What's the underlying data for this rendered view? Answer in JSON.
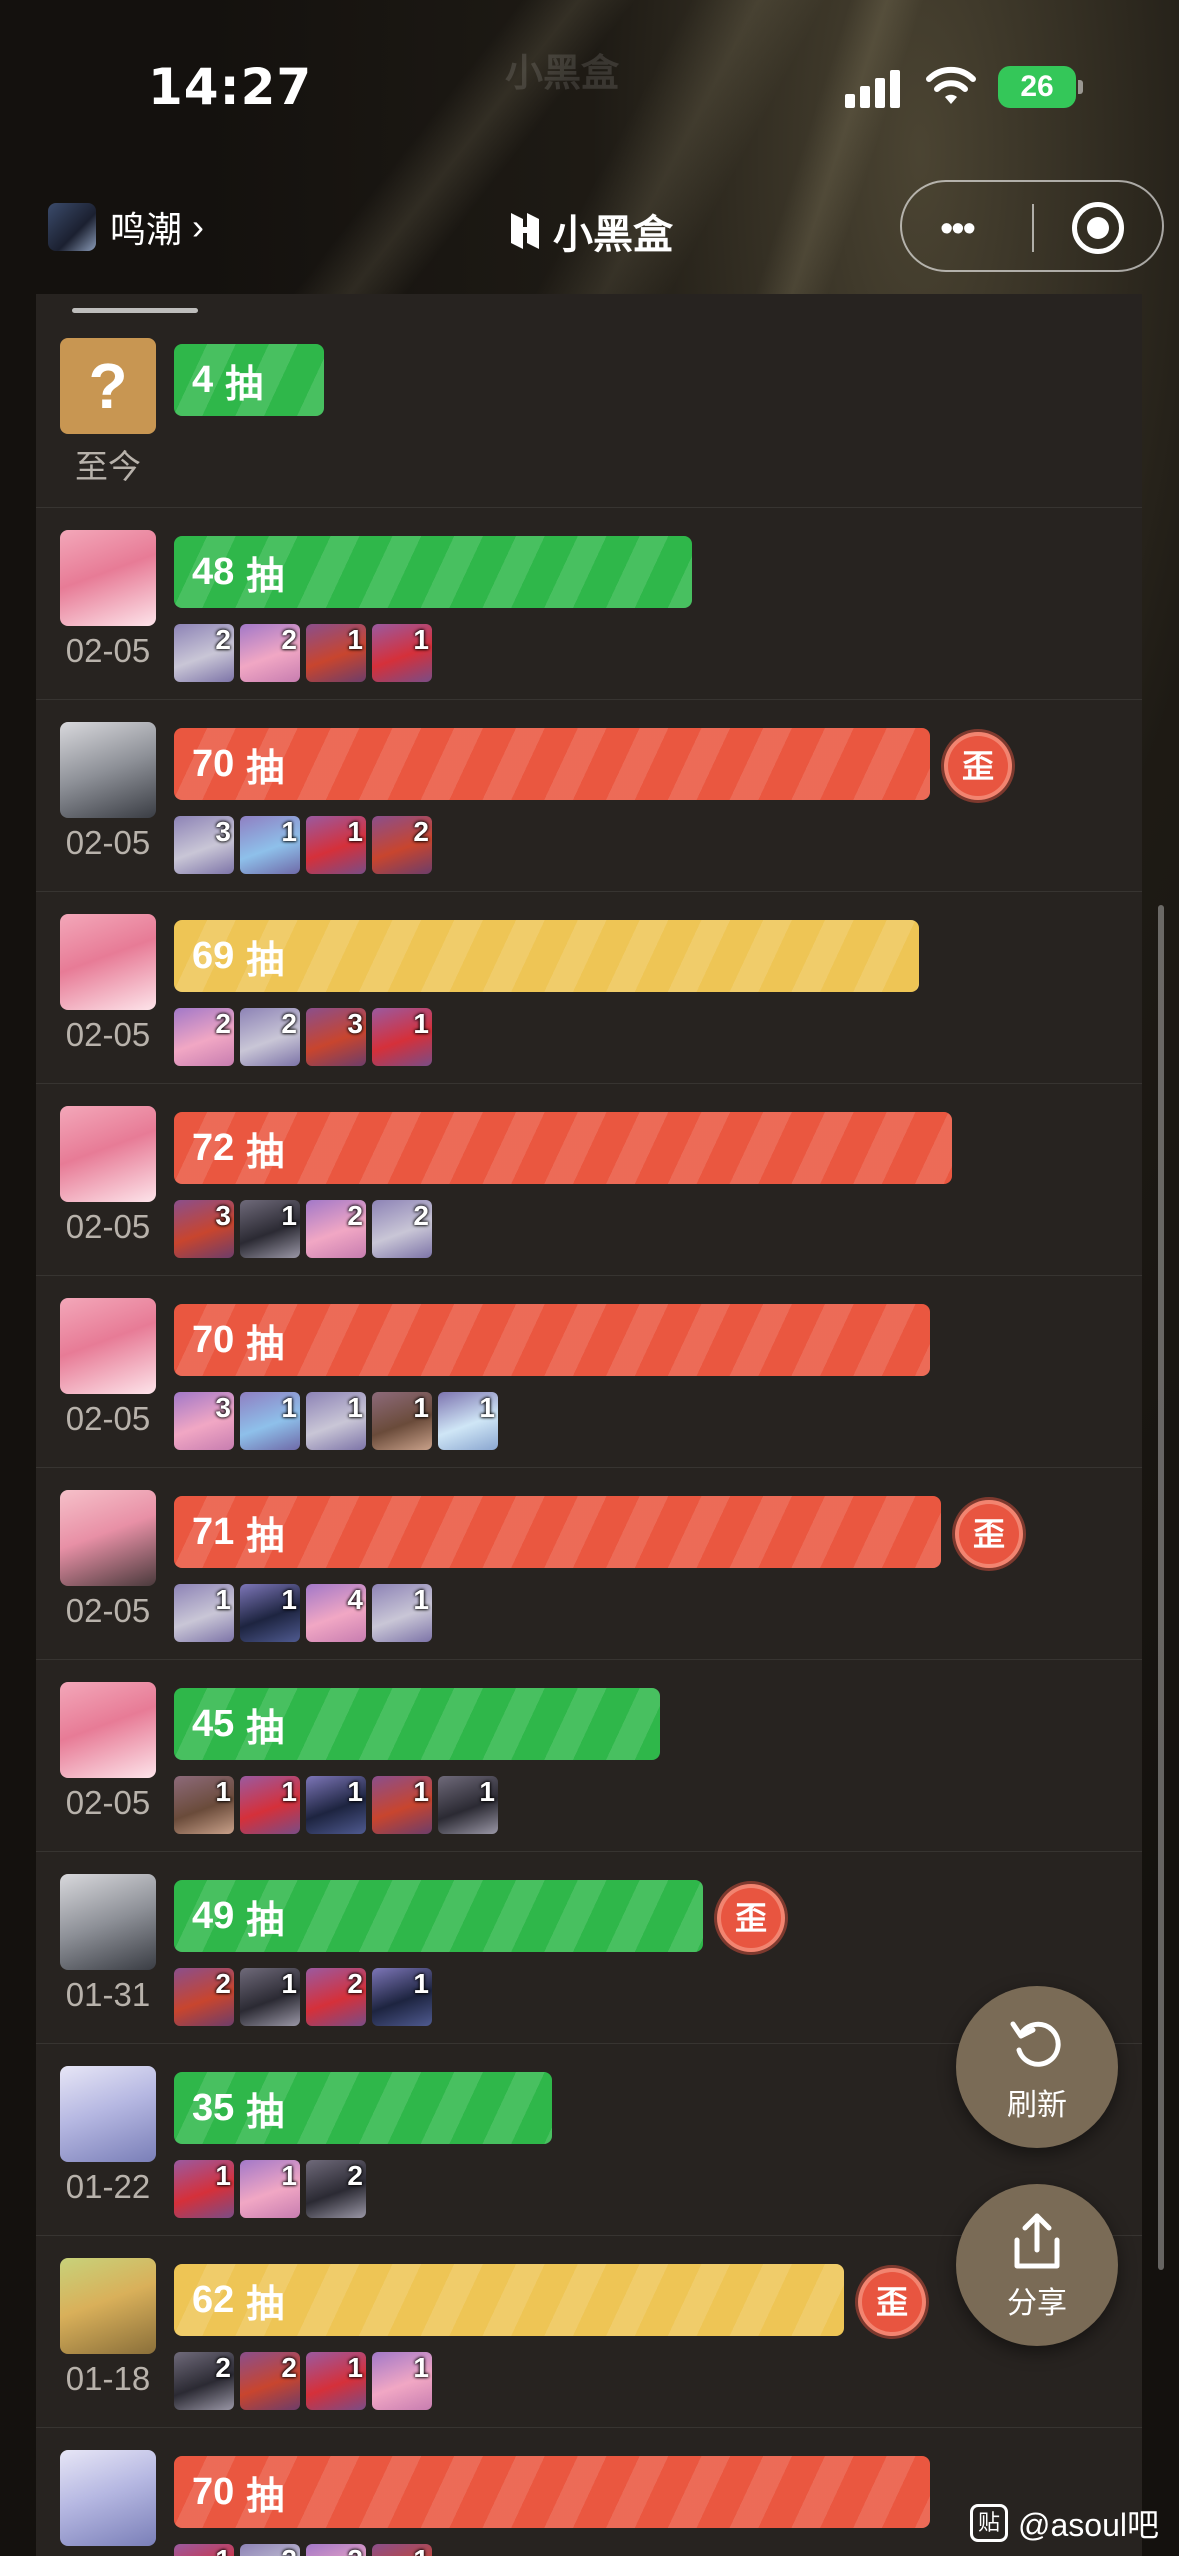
{
  "status_bar": {
    "time": "14:27",
    "battery": "26",
    "faint_logo": "小黑盒"
  },
  "nav": {
    "game_name": "鸣潮",
    "chevron": "›",
    "brand": "小黑盒",
    "more": "•••"
  },
  "unit": "抽",
  "wai_label": "歪",
  "colors": {
    "green": "#2fb74a",
    "red": "#ea5740",
    "yellow": "#eec555",
    "panel": "#272320"
  },
  "records": [
    {
      "pulls": "4",
      "date": "至今",
      "color": "green",
      "wai": false,
      "avatar": "question",
      "chars": []
    },
    {
      "pulls": "48",
      "date": "02-05",
      "color": "green",
      "wai": false,
      "avatar": "pink",
      "chars": [
        {
          "tone": "silver",
          "count": "2"
        },
        {
          "tone": "pink",
          "count": "2"
        },
        {
          "tone": "red",
          "count": "1"
        },
        {
          "tone": "crimson",
          "count": "1"
        }
      ]
    },
    {
      "pulls": "70",
      "date": "02-05",
      "color": "red",
      "wai": true,
      "avatar": "white",
      "chars": [
        {
          "tone": "silver",
          "count": "3"
        },
        {
          "tone": "blue",
          "count": "1"
        },
        {
          "tone": "crimson",
          "count": "1"
        },
        {
          "tone": "red",
          "count": "2"
        }
      ]
    },
    {
      "pulls": "69",
      "date": "02-05",
      "color": "yellow",
      "wai": false,
      "avatar": "pink",
      "chars": [
        {
          "tone": "pink",
          "count": "2"
        },
        {
          "tone": "silver",
          "count": "2"
        },
        {
          "tone": "red",
          "count": "3"
        },
        {
          "tone": "crimson",
          "count": "1"
        }
      ]
    },
    {
      "pulls": "72",
      "date": "02-05",
      "color": "red",
      "wai": false,
      "avatar": "pink",
      "chars": [
        {
          "tone": "red",
          "count": "3"
        },
        {
          "tone": "dark",
          "count": "1"
        },
        {
          "tone": "pink",
          "count": "2"
        },
        {
          "tone": "silver",
          "count": "2"
        }
      ]
    },
    {
      "pulls": "70",
      "date": "02-05",
      "color": "red",
      "wai": false,
      "avatar": "pink",
      "chars": [
        {
          "tone": "pink",
          "count": "3"
        },
        {
          "tone": "blue",
          "count": "1"
        },
        {
          "tone": "silver",
          "count": "1"
        },
        {
          "tone": "brown",
          "count": "1"
        },
        {
          "tone": "ice",
          "count": "1"
        }
      ]
    },
    {
      "pulls": "71",
      "date": "02-05",
      "color": "red",
      "wai": true,
      "avatar": "rose",
      "chars": [
        {
          "tone": "silver",
          "count": "1"
        },
        {
          "tone": "navy",
          "count": "1"
        },
        {
          "tone": "pink",
          "count": "4"
        },
        {
          "tone": "silver",
          "count": "1"
        }
      ]
    },
    {
      "pulls": "45",
      "date": "02-05",
      "color": "green",
      "wai": false,
      "avatar": "pink",
      "chars": [
        {
          "tone": "brown",
          "count": "1"
        },
        {
          "tone": "crimson",
          "count": "1"
        },
        {
          "tone": "navy",
          "count": "1"
        },
        {
          "tone": "red",
          "count": "1"
        },
        {
          "tone": "dark",
          "count": "1"
        }
      ]
    },
    {
      "pulls": "49",
      "date": "01-31",
      "color": "green",
      "wai": true,
      "avatar": "white",
      "chars": [
        {
          "tone": "red",
          "count": "2"
        },
        {
          "tone": "dark",
          "count": "1"
        },
        {
          "tone": "crimson",
          "count": "2"
        },
        {
          "tone": "navy",
          "count": "1"
        }
      ]
    },
    {
      "pulls": "35",
      "date": "01-22",
      "color": "green",
      "wai": false,
      "avatar": "lavender",
      "chars": [
        {
          "tone": "crimson",
          "count": "1"
        },
        {
          "tone": "pink",
          "count": "1"
        },
        {
          "tone": "dark",
          "count": "2"
        }
      ]
    },
    {
      "pulls": "62",
      "date": "01-18",
      "color": "yellow",
      "wai": true,
      "avatar": "blonde",
      "chars": [
        {
          "tone": "dark",
          "count": "2"
        },
        {
          "tone": "red",
          "count": "2"
        },
        {
          "tone": "crimson",
          "count": "1"
        },
        {
          "tone": "pink",
          "count": "1"
        }
      ]
    },
    {
      "pulls": "70",
      "date": "",
      "color": "red",
      "wai": false,
      "avatar": "lavender",
      "chars": [
        {
          "tone": "crimson",
          "count": "1"
        },
        {
          "tone": "silver",
          "count": "2"
        },
        {
          "tone": "pink",
          "count": "2"
        },
        {
          "tone": "red",
          "count": "1"
        }
      ]
    }
  ],
  "fabs": {
    "refresh_label": "刷新",
    "share_label": "分享"
  },
  "watermark": {
    "icon_text": "贴",
    "text": "@asoul吧"
  }
}
